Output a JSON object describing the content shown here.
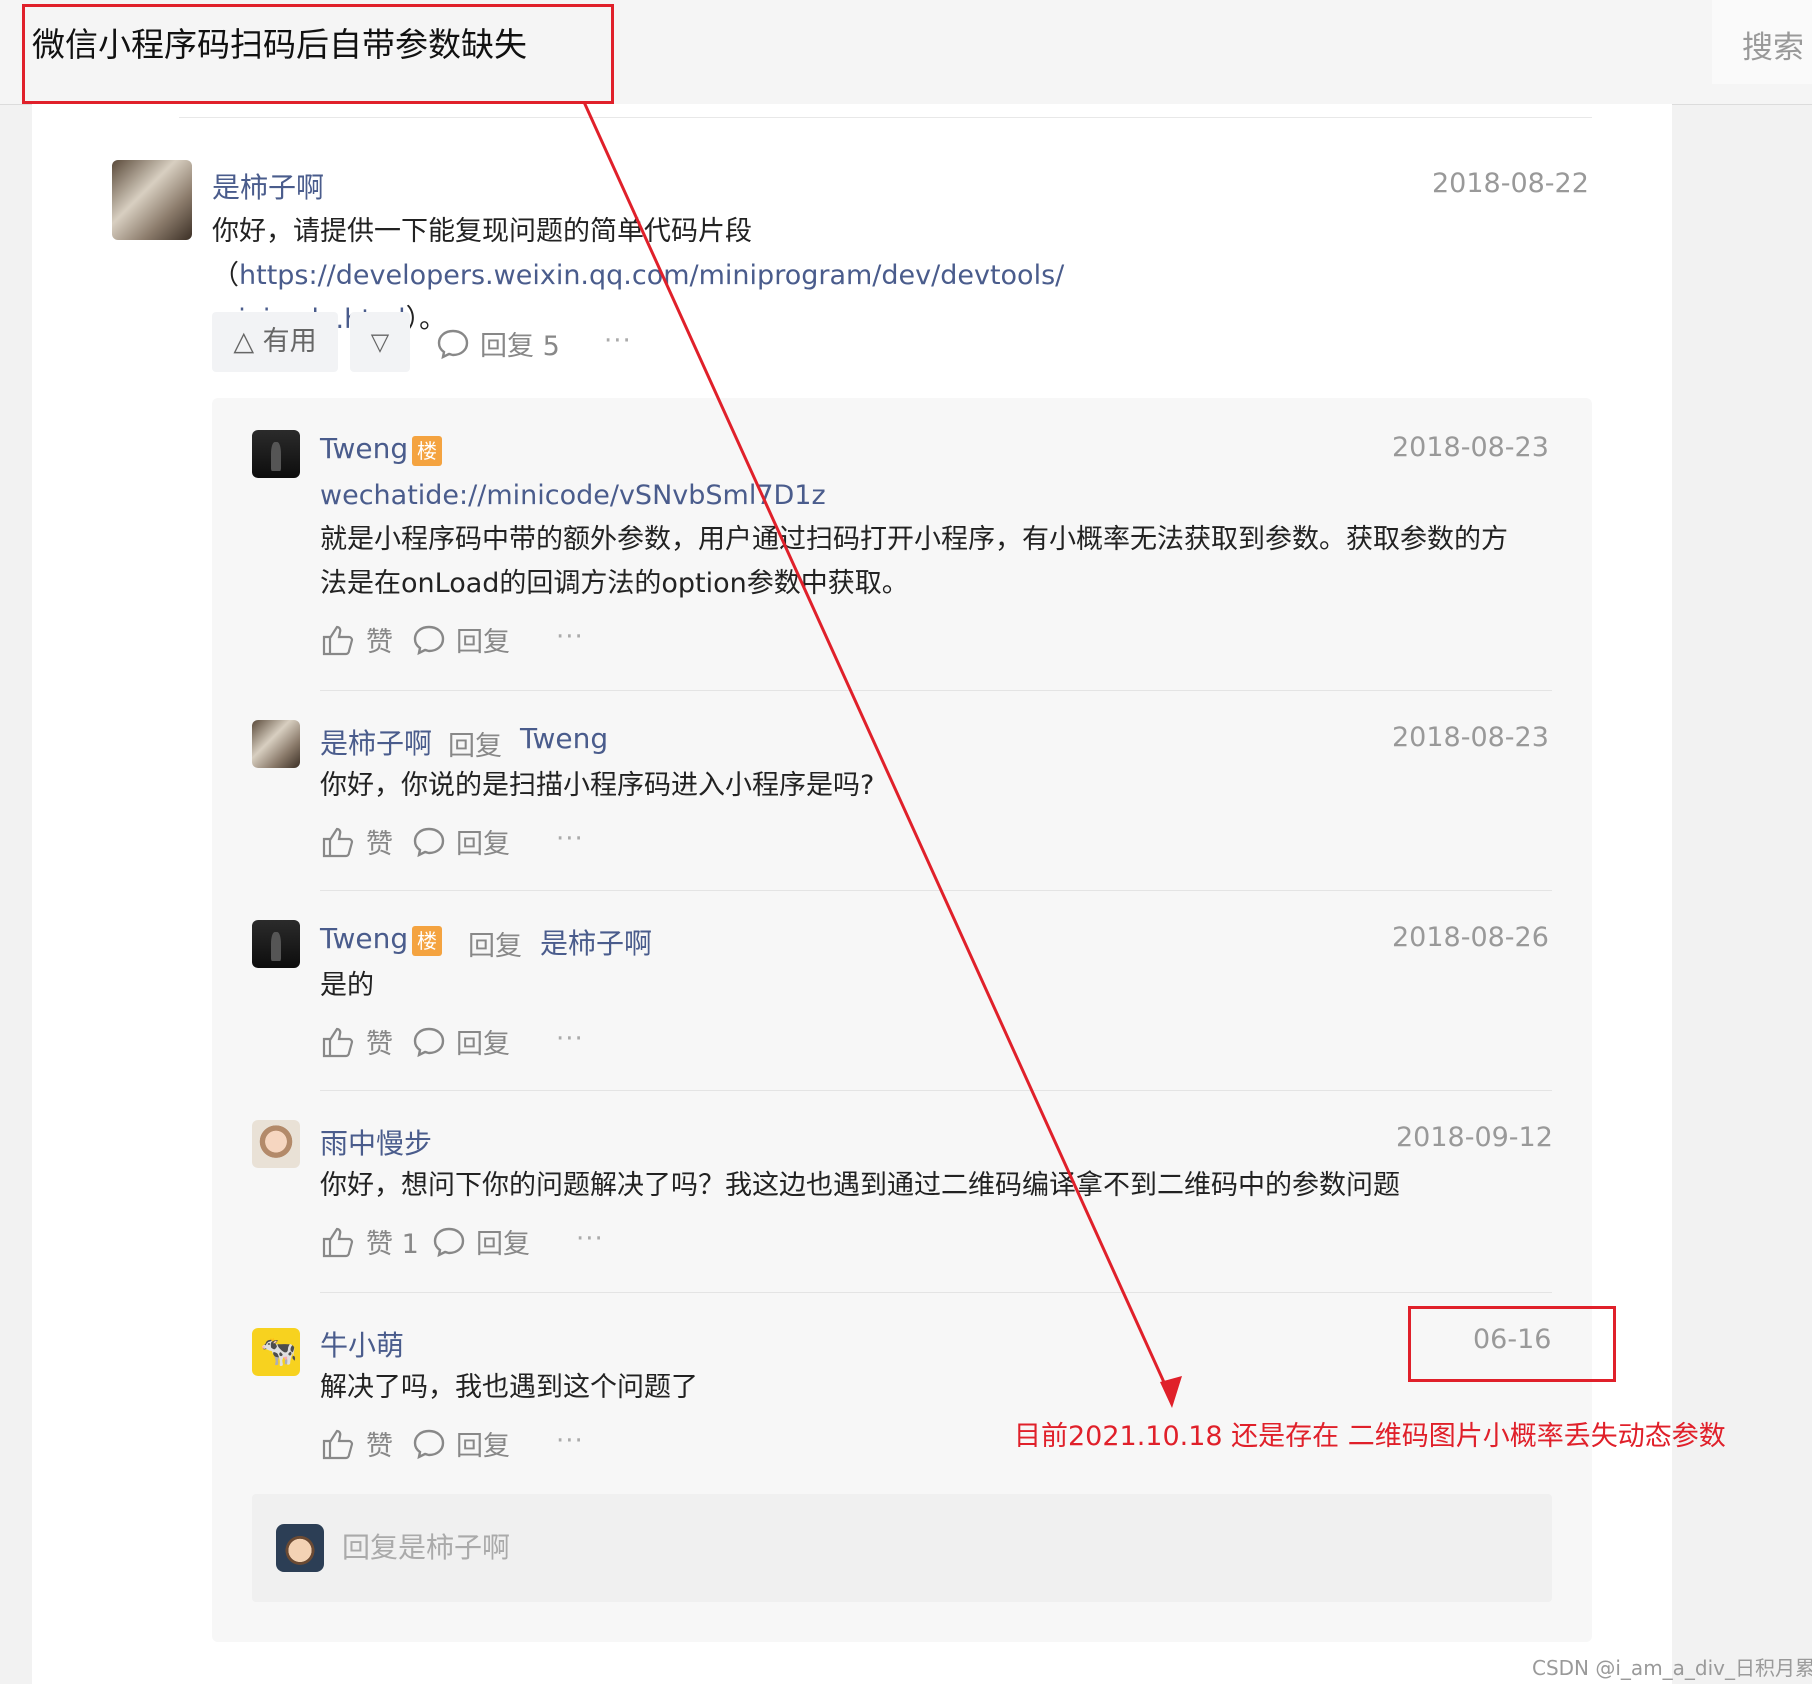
{
  "header": {
    "title": "微信小程序码扫码后自带参数缺失",
    "search_label": "搜索"
  },
  "main_post": {
    "author": "是柿子啊",
    "date": "2018-08-22",
    "text_before": "你好，请提供一下能复现问题的简单代码片段（",
    "link_part1": "https://developers.weixin.qq.com/miniprogram/dev/devtools/",
    "link_part2": "minicode.html",
    "text_after": "）。",
    "useful_label": "有用",
    "reply_label": "回复 5",
    "more": "···"
  },
  "replies": [
    {
      "author": "Tweng",
      "badge": "楼",
      "date": "2018-08-23",
      "link": "wechatide://minicode/vSNvbSml7D1z",
      "line1": "就是小程序码中带的额外参数，用户通过扫码打开小程序，有小概率无法获取到参数。获取参数的方",
      "line2": "法是在onLoad的回调方法的option参数中获取。",
      "like": "赞",
      "reply": "回复",
      "more": "···"
    },
    {
      "author": "是柿子啊",
      "reply_word": "回复",
      "reply_to": "Tweng",
      "date": "2018-08-23",
      "text": "你好，你说的是扫描小程序码进入小程序是吗?",
      "like": "赞",
      "reply": "回复",
      "more": "···"
    },
    {
      "author": "Tweng",
      "badge": "楼",
      "reply_word": "回复",
      "reply_to": "是柿子啊",
      "date": "2018-08-26",
      "text": "是的",
      "like": "赞",
      "reply": "回复",
      "more": "···"
    },
    {
      "author": "雨中慢步",
      "date": "2018-09-12",
      "text": "你好，想问下你的问题解决了吗？我这边也遇到通过二维码编译拿不到二维码中的参数问题",
      "like": "赞 1",
      "reply": "回复",
      "more": "···"
    },
    {
      "author": "牛小萌",
      "date": "06-16",
      "text": "解决了吗，我也遇到这个问题了",
      "like": "赞",
      "reply": "回复",
      "more": "···"
    }
  ],
  "reply_input": {
    "placeholder": "回复是柿子啊"
  },
  "annotation": {
    "text": "目前2021.10.18 还是存在 二维码图片小概率丢失动态参数",
    "color": "#e0202a"
  },
  "watermark": "CSDN @i_am_a_div_日积月累_",
  "colors": {
    "link": "#4a5c8c",
    "badge": "#f4a340",
    "annotation": "#e0202a"
  }
}
